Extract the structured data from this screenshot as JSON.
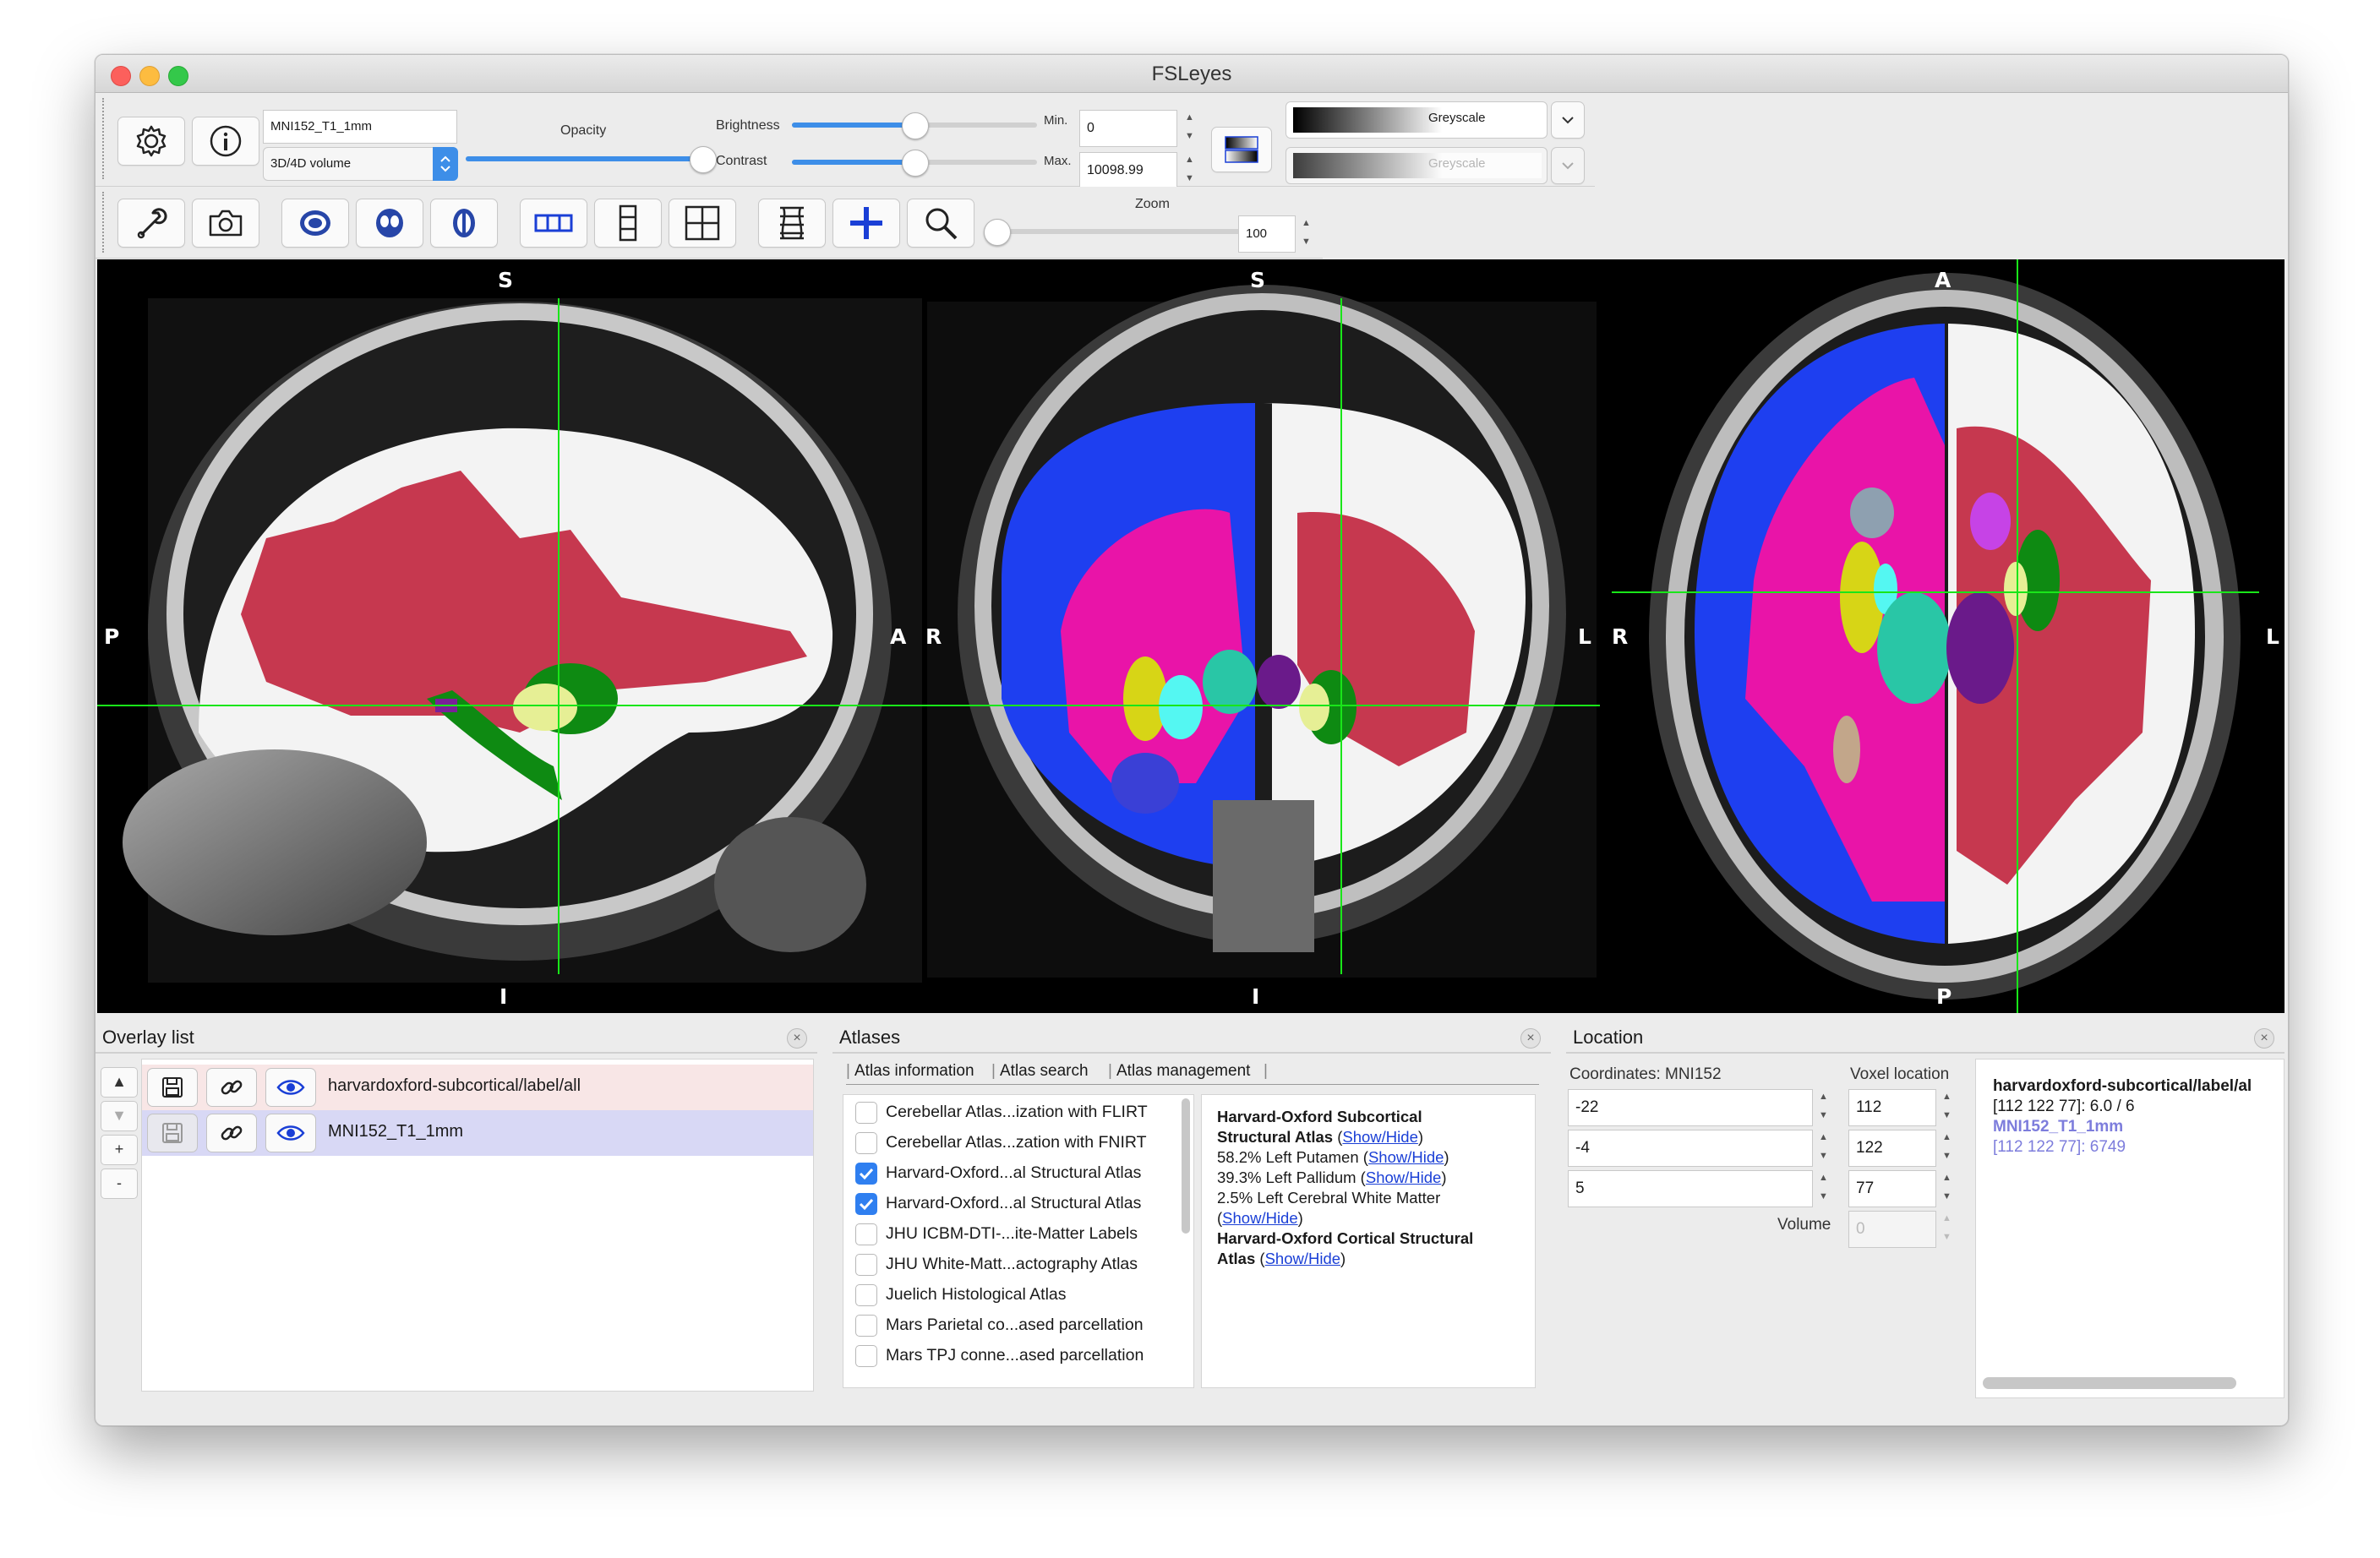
{
  "window": {
    "title": "FSLeyes"
  },
  "toolbar1": {
    "overlay_name": "MNI152_T1_1mm",
    "overlay_type": "3D/4D volume",
    "opacity_label": "Opacity",
    "brightness_label": "Brightness",
    "contrast_label": "Contrast",
    "min_label": "Min.",
    "max_label": "Max.",
    "min_value": "0",
    "max_value": "10098.99",
    "colormap1": "Greyscale",
    "colormap2": "Greyscale",
    "opacity_level": 1.0,
    "brightness_level": 0.5,
    "contrast_level": 0.5
  },
  "toolbar2": {
    "zoom_label": "Zoom",
    "zoom_value": "100",
    "zoom_level": 0.0
  },
  "views": {
    "sagittal": {
      "top": "S",
      "bottom": "I",
      "left": "P",
      "right": "A"
    },
    "coronal": {
      "top": "S",
      "bottom": "I",
      "left": "R",
      "right": "L"
    },
    "axial": {
      "top": "A",
      "bottom": "P",
      "left": "R",
      "right": "L"
    }
  },
  "overlay_list": {
    "title": "Overlay list",
    "items": [
      {
        "name": "harvardoxford-subcortical/label/all"
      },
      {
        "name": "MNI152_T1_1mm"
      }
    ],
    "add": "+",
    "remove": "-"
  },
  "atlases": {
    "title": "Atlases",
    "tabs": [
      "Atlas information",
      "Atlas search",
      "Atlas management"
    ],
    "list": [
      {
        "label": "Cerebellar Atlas...ization with FLIRT",
        "checked": false
      },
      {
        "label": "Cerebellar Atlas...zation with FNIRT",
        "checked": false
      },
      {
        "label": "Harvard-Oxford...al Structural Atlas",
        "checked": true
      },
      {
        "label": "Harvard-Oxford...al Structural Atlas",
        "checked": true
      },
      {
        "label": "JHU ICBM-DTI-...ite-Matter Labels",
        "checked": false
      },
      {
        "label": "JHU White-Matt...actography Atlas",
        "checked": false
      },
      {
        "label": "Juelich Histological Atlas",
        "checked": false
      },
      {
        "label": "Mars Parietal co...ased parcellation",
        "checked": false
      },
      {
        "label": "Mars TPJ conne...ased parcellation",
        "checked": false
      }
    ],
    "info": {
      "sub_title1": "Harvard-Oxford Subcortical",
      "sub_title2": "Structural Atlas",
      "show_hide": "Show/Hide",
      "lines": [
        {
          "text": "58.2% Left Putamen"
        },
        {
          "text": "39.3% Left Pallidum"
        },
        {
          "text": "2.5% Left Cerebral White Matter"
        }
      ],
      "cort_title1": "Harvard-Oxford Cortical Structural",
      "cort_title2": "Atlas"
    }
  },
  "location": {
    "title": "Location",
    "coord_label": "Coordinates: MNI152",
    "voxel_label": "Voxel location",
    "coords": [
      "-22",
      "-4",
      "5"
    ],
    "voxels": [
      "112",
      "122",
      "77"
    ],
    "volume_label": "Volume",
    "volume_value": "0",
    "info": {
      "line1": "harvardoxford-subcortical/label/al",
      "line2": "[112 122 77]: 6.0 / 6",
      "line3": "MNI152_T1_1mm",
      "line4": "[112 122 77]: 6749"
    }
  },
  "colors": {
    "accent": "#2f7ff0",
    "crosshair": "#19e619",
    "overlay_row1": "#f8e6e6",
    "overlay_row2": "#d8d8f5"
  }
}
